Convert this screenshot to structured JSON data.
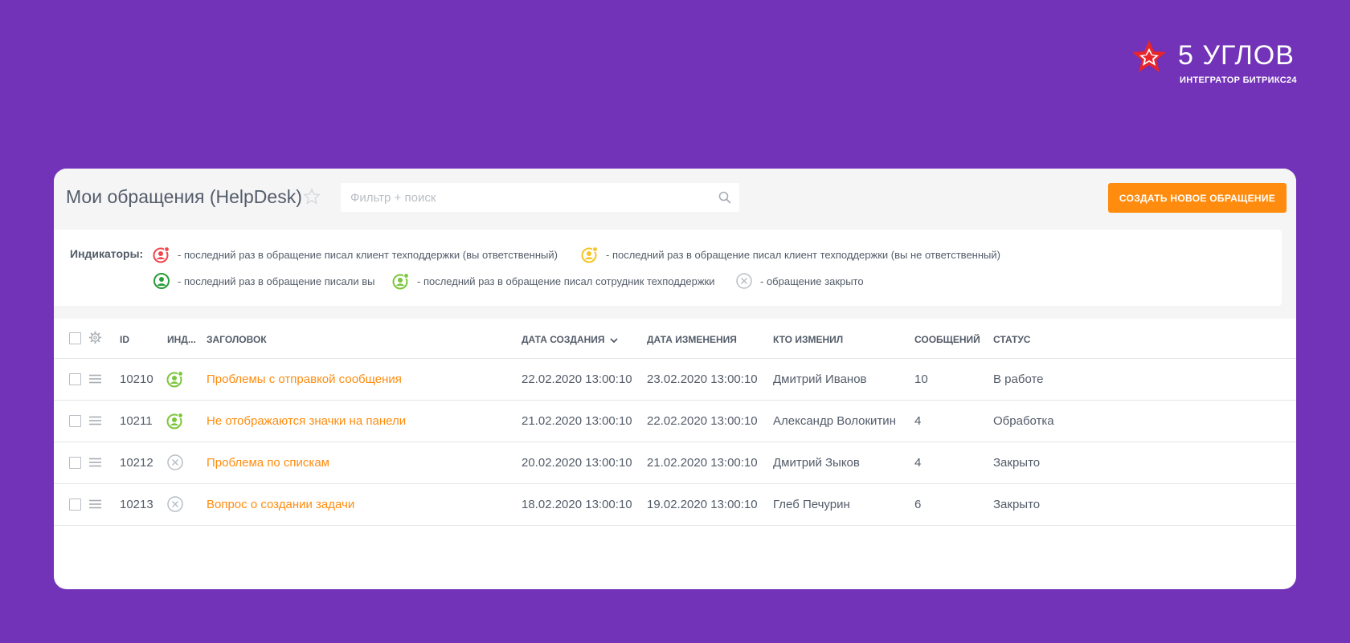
{
  "brand": {
    "name": "5 УГЛОВ",
    "subtitle": "ИНТЕГРАТОР БИТРИКС24",
    "star_color": "#e8252a"
  },
  "header": {
    "title": "Мои обращения (HelpDesk)",
    "search_placeholder": "Фильтр + поиск",
    "search_value": "",
    "create_button": "СОЗДАТЬ НОВОЕ ОБРАЩЕНИЕ",
    "accent_color": "#ff8c0e"
  },
  "indicators": {
    "label": "Индикаторы:",
    "items": [
      {
        "icon": "red-user-icon",
        "color": "#f0474d",
        "text": "- последний раз в обращение писал клиент техподдержки (вы ответственный)"
      },
      {
        "icon": "yellow-user-icon",
        "color": "#f5c526",
        "text": "- последний раз в обращение писал клиент техподдержки (вы не ответственный)"
      },
      {
        "icon": "green-user-icon",
        "color": "#2a9d3b",
        "text": "- последний раз в обращение писали вы"
      },
      {
        "icon": "lightgreen-user-icon",
        "color": "#7bc63a",
        "text": "- последний раз в обращение писал сотрудник техподдержки"
      },
      {
        "icon": "closed-icon",
        "color": "#b9bec4",
        "text": "- обращение закрыто"
      }
    ]
  },
  "table": {
    "columns": {
      "id": "ID",
      "ind": "ИНД...",
      "title": "ЗАГОЛОВОК",
      "created": "ДАТА СОЗДАНИЯ",
      "modified": "ДАТА ИЗМЕНЕНИЯ",
      "changed_by": "КТО ИЗМЕНИЛ",
      "messages": "СООБЩЕНИЙ",
      "status": "СТАТУС"
    },
    "rows": [
      {
        "id": "10210",
        "indicator": "lightgreen-user-icon",
        "title": "Проблемы с отправкой сообщения",
        "created": "22.02.2020 13:00:10",
        "modified": "23.02.2020 13:00:10",
        "changed_by": "Дмитрий Иванов",
        "messages": "10",
        "status": "В работе"
      },
      {
        "id": "10211",
        "indicator": "lightgreen-user-icon",
        "title": "Не отображаются значки на панели",
        "created": "21.02.2020 13:00:10",
        "modified": "22.02.2020 13:00:10",
        "changed_by": "Александр Волокитин",
        "messages": "4",
        "status": "Обработка"
      },
      {
        "id": "10212",
        "indicator": "closed-icon",
        "title": "Проблема по спискам",
        "created": "20.02.2020 13:00:10",
        "modified": "21.02.2020 13:00:10",
        "changed_by": "Дмитрий Зыков",
        "messages": "4",
        "status": "Закрыто"
      },
      {
        "id": "10213",
        "indicator": "closed-icon",
        "title": "Вопрос о создании задачи",
        "created": "18.02.2020 13:00:10",
        "modified": "19.02.2020 13:00:10",
        "changed_by": "Глеб Печурин",
        "messages": "6",
        "status": "Закрыто"
      }
    ]
  }
}
